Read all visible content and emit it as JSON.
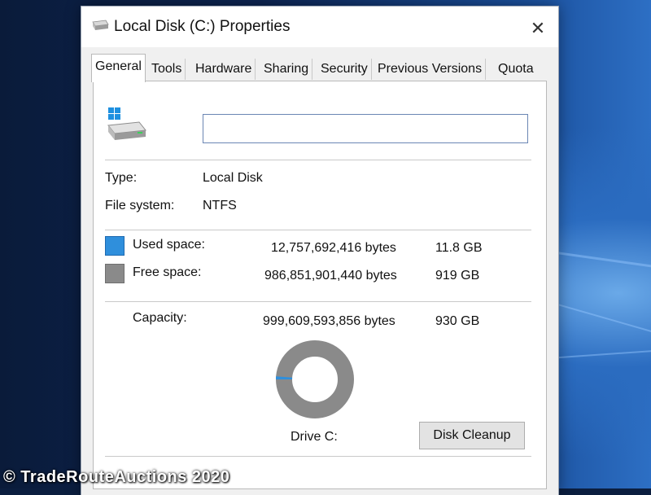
{
  "window": {
    "title": "Local Disk (C:) Properties"
  },
  "tabs": [
    {
      "label": "General"
    },
    {
      "label": "Tools"
    },
    {
      "label": "Hardware"
    },
    {
      "label": "Sharing"
    },
    {
      "label": "Security"
    },
    {
      "label": "Previous Versions"
    },
    {
      "label": "Quota"
    }
  ],
  "general": {
    "name_value": "",
    "type_label": "Type:",
    "type_value": "Local Disk",
    "fs_label": "File system:",
    "fs_value": "NTFS",
    "used": {
      "label": "Used space:",
      "bytes": "12,757,692,416 bytes",
      "size": "11.8 GB",
      "color": "#2f8fdc"
    },
    "free": {
      "label": "Free space:",
      "bytes": "986,851,901,440 bytes",
      "size": "919 GB",
      "color": "#8a8a8a"
    },
    "capacity": {
      "label": "Capacity:",
      "bytes": "999,609,593,856 bytes",
      "size": "930 GB"
    },
    "drive_label": "Drive C:",
    "cleanup_label": "Disk Cleanup",
    "used_fraction": 0.0128
  },
  "watermark": "© TradeRouteAuctions 2020"
}
